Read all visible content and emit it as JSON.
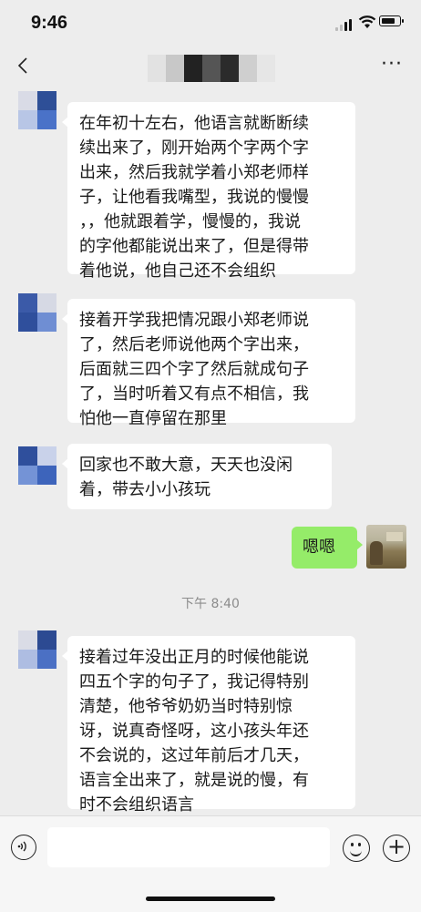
{
  "status_bar": {
    "time": "9:46"
  },
  "header": {
    "back_icon": "chevron-left-icon",
    "more_label": "···"
  },
  "messages": [
    {
      "side": "left",
      "text": "在年初十左右，他语言就断断续\n续出来了，刚开始两个字两个字\n出来，然后我就学着小郑老师样\n子，让他看我嘴型，我说的慢慢\n，，他就跟着学，慢慢的，我说\n的字他都能说出来了，但是得带\n着他说，他自己还不会组织"
    },
    {
      "side": "left",
      "text": "接着开学我把情况跟小郑老师说\n了，然后老师说他两个字出来，\n后面就三四个字了然后就成句子\n了，当时听着又有点不相信，我\n怕他一直停留在那里"
    },
    {
      "side": "left",
      "text": "回家也不敢大意，天天也没闲\n着，带去小小孩玩"
    },
    {
      "side": "right",
      "text": "嗯嗯"
    },
    {
      "side": "left",
      "text": "接着过年没出正月的时候他能说\n四五个字的句子了，我记得特别\n清楚，他爷爷奶奶当时特别惊\n讶，说真奇怪呀，这小孩头年还\n不会说的，这过年前后才几天，\n语言全出来了，就是说的慢，有\n时不会组织语言"
    }
  ],
  "timestamp": "下午 8:40",
  "input_bar": {
    "voice_icon": "voice-icon",
    "emoji_icon": "emoji-icon",
    "plus_label": "+"
  },
  "colors": {
    "background": "#ededed",
    "bubble_left": "#ffffff",
    "bubble_right": "#95ec69"
  }
}
